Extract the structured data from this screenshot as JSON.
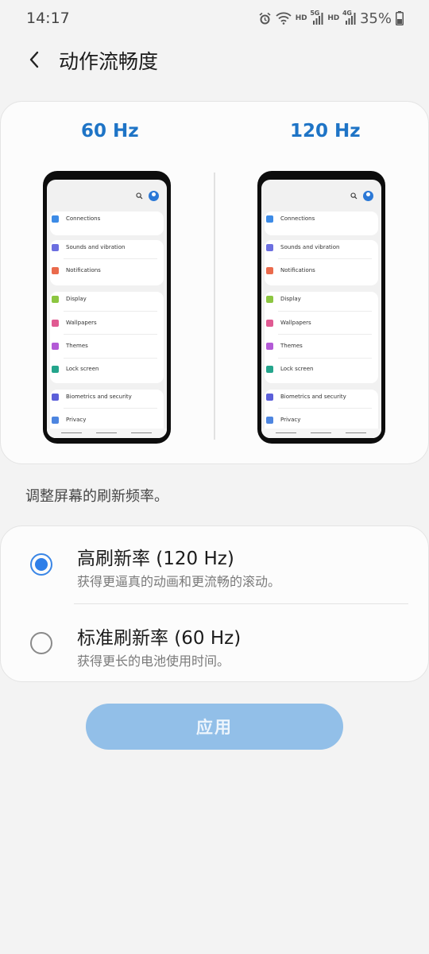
{
  "status_bar": {
    "time": "14:17",
    "icons": [
      "alarm-icon",
      "wifi-icon",
      "hd-icon",
      "5g-signal-icon",
      "hd-icon",
      "4g-signal-icon",
      "battery-icon"
    ],
    "hd_label": "HD",
    "net1": "5G",
    "net2": "4G",
    "battery": "35%"
  },
  "header": {
    "back_icon": "chevron-left-icon",
    "title": "动作流畅度"
  },
  "preview": {
    "left_label": "60 Hz",
    "right_label": "120 Hz",
    "accent": "#1e74c6",
    "screen": {
      "items": [
        {
          "label": "Connections",
          "icon": "wifi-icon",
          "color": "#3d8be6"
        },
        {
          "label": "Sounds and vibration",
          "icon": "volume-icon",
          "color": "#6c6fe0"
        },
        {
          "label": "Notifications",
          "icon": "bell-icon",
          "color": "#ea6a4c"
        },
        {
          "label": "Display",
          "icon": "sun-icon",
          "color": "#8cc641"
        },
        {
          "label": "Wallpapers",
          "icon": "image-icon",
          "color": "#e05a92"
        },
        {
          "label": "Themes",
          "icon": "brush-icon",
          "color": "#b35ad6"
        },
        {
          "label": "Lock screen",
          "icon": "lock-icon",
          "color": "#24a58c"
        },
        {
          "label": "Biometrics and security",
          "icon": "shield-icon",
          "color": "#5b5fd9"
        },
        {
          "label": "Privacy",
          "icon": "privacy-icon",
          "color": "#4d85e0"
        }
      ]
    }
  },
  "description": "调整屏幕的刷新频率。",
  "options": [
    {
      "title": "高刷新率 (120 Hz)",
      "subtitle": "获得更逼真的动画和更流畅的滚动。",
      "selected": true
    },
    {
      "title": "标准刷新率 (60 Hz)",
      "subtitle": "获得更长的电池使用时间。",
      "selected": false
    }
  ],
  "apply_button": {
    "label": "应用",
    "color": "#92bfe8"
  }
}
